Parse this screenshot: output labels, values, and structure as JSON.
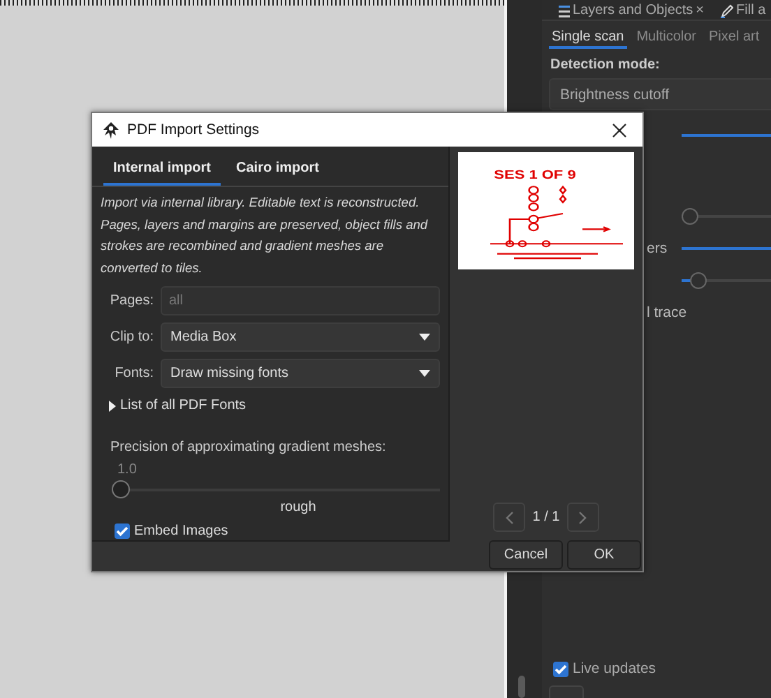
{
  "dock": {
    "tabs": [
      {
        "label": "Layers and Objects",
        "close": "×",
        "selected": false
      },
      {
        "label": "Fill a",
        "selected": false
      }
    ],
    "trace_tabs": [
      {
        "label": "Single scan",
        "selected": true
      },
      {
        "label": "Multicolor",
        "selected": false
      },
      {
        "label": "Pixel art",
        "selected": false
      }
    ],
    "detection_mode": {
      "label": "Detection mode:",
      "value": "Brightness cutoff"
    },
    "rows": [
      {
        "kind": "slider",
        "level": 1
      },
      {
        "kind": "slider",
        "level": 0
      },
      {
        "kind": "slider",
        "label": "ers",
        "level": 1
      },
      {
        "kind": "slider",
        "level": 0.12
      },
      {
        "kind": "text",
        "label": "l trace"
      }
    ],
    "live_updates": {
      "label": "Live updates",
      "checked": true
    }
  },
  "dialog": {
    "title": "PDF Import Settings",
    "tabs": [
      {
        "label": "Internal import",
        "selected": true
      },
      {
        "label": "Cairo import",
        "selected": false
      }
    ],
    "description": "Import via internal library. Editable text is reconstructed. Pages, layers and margins are preserved, object fills and strokes are recombined and gradient meshes are converted to tiles.",
    "fields": [
      {
        "kind": "entry",
        "label": "Pages:",
        "placeholder": "all"
      },
      {
        "kind": "dropdown",
        "label": "Clip to:",
        "value": "Media Box"
      },
      {
        "kind": "dropdown",
        "label": "Fonts:",
        "value": "Draw missing fonts"
      }
    ],
    "expander": {
      "label": "List of all PDF Fonts",
      "expanded": false
    },
    "precision": {
      "label": "Precision of approximating gradient meshes:",
      "reading": "1.0",
      "level": 0,
      "caption": "rough"
    },
    "embed_images": {
      "label": "Embed Images",
      "checked": true
    },
    "preview": {
      "heading": "SES 1 OF 9",
      "page": "1 / 1",
      "prev_disabled": true,
      "next_disabled": true
    },
    "buttons": [
      {
        "label": "Cancel"
      },
      {
        "label": "OK"
      }
    ]
  }
}
